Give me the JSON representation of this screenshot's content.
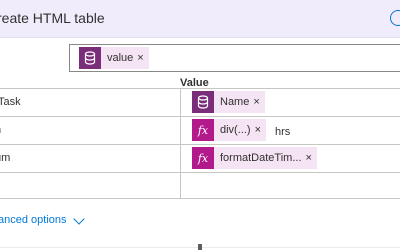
{
  "header": {
    "title": "reate HTML table"
  },
  "from_field": {
    "token": {
      "label": "value",
      "remove": "×"
    }
  },
  "table": {
    "column_header": "Value",
    "rows": [
      {
        "key": "/Task",
        "token_label": "Name",
        "token_kind": "database-icon",
        "remove": "×",
        "suffix": ""
      },
      {
        "key": "n",
        "token_label": "div(...)",
        "token_kind": "fx-icon",
        "remove": "×",
        "suffix": "hrs"
      },
      {
        "key": "um",
        "token_label": "formatDateTim...",
        "token_kind": "fx-icon",
        "remove": "×",
        "suffix": ""
      }
    ]
  },
  "footer": {
    "advanced_options": "anced options"
  },
  "icons": {
    "fx_glyph": "fx"
  },
  "colors": {
    "header_bg": "#f1ecfc",
    "token_bg": "#f5e4f3",
    "db_icon_bg": "#7a2e7a",
    "fx_icon_bg": "#b21a8c",
    "link": "#0078d4"
  }
}
